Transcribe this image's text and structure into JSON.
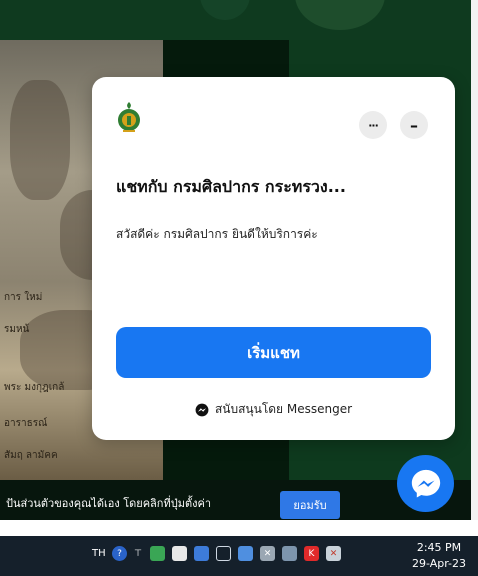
{
  "widget": {
    "title": "แชทกับ กรมศิลปากร กระทรวง...",
    "greeting": "สวัสดีค่ะ กรมศิลปากร ยินดีให้บริการค่ะ",
    "start_button": "เริ่มแชท",
    "powered_by": "สนับสนุนโดย Messenger",
    "more_button": "···",
    "minimize_button": "–"
  },
  "background": {
    "photo_labels": [
      "การ ใหม่",
      "รมหน้",
      "พระ มงกุฎเกล้",
      "อาราธรณ์",
      "สัมฤ ลามัคค"
    ]
  },
  "cookie_bar": {
    "text": "ปันส่วนตัวของคุณได้เอง โดยคลิกที่ปุ่มตั้งค่า",
    "accept_button": "ยอมรับ"
  },
  "taskbar": {
    "language": "TH",
    "time": "2:45 PM",
    "date": "29-Apr-23",
    "tray_icons": [
      "help-icon",
      "pin-icon",
      "chat-icon",
      "message-icon",
      "shield-icon",
      "network-icon",
      "monitor-icon",
      "volume-muted-icon",
      "device-icon",
      "kaspersky-icon",
      "flag-icon"
    ]
  },
  "colors": {
    "messenger_blue": "#1877f2",
    "accept_blue": "#2f78e6",
    "taskbar_bg": "#15202b"
  }
}
